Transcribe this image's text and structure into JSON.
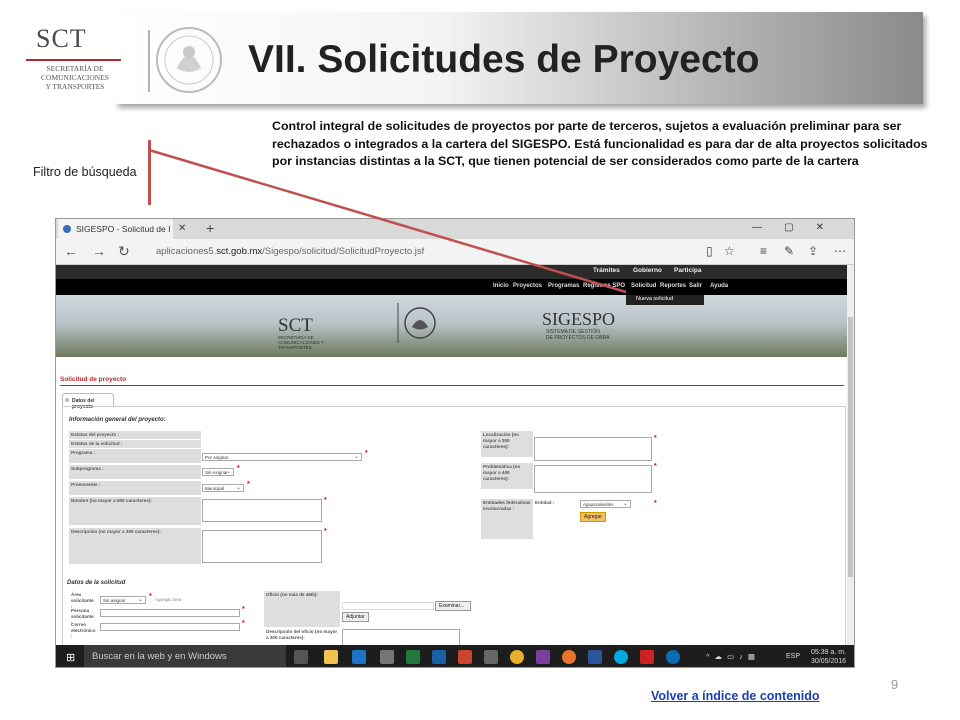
{
  "slide": {
    "title": "VII. Solicitudes de Proyecto",
    "description": "Control integral de solicitudes de proyectos por parte de terceros, sujetos a evaluación preliminar para ser rechazados o integrados a la cartera del SIGESPO. Está funcionalidad es para dar de alta proyectos solicitados por instancias distintas a la SCT, que tienen potencial de ser considerados como parte de la cartera",
    "annotation": "Filtro de búsqueda",
    "page_number": "9",
    "back_link": "Volver a índice de contenido",
    "accent_color": "#c0504d"
  },
  "logo": {
    "sct": "SCT",
    "sct_sub_1": "SECRETARÍA DE",
    "sct_sub_2": "COMUNICACIONES",
    "sct_sub_3": "Y TRANSPORTES"
  },
  "browser": {
    "tab_title": "SIGESPO - Solicitud de I",
    "url_prefix": "aplicaciones5.",
    "url_domain": "sct.gob.mx",
    "url_path": "/Sigespo/solicitud/SolicitudProyecto.jsf"
  },
  "app": {
    "topnav": [
      "Trámites",
      "Gobierno",
      "Participa"
    ],
    "mainnav": [
      "Inicio",
      "Proyectos",
      "Programas",
      "Registros SPO",
      "Solicitud",
      "Reportes",
      "Salir",
      "Ayuda"
    ],
    "dropdown_item": "Nueva solicitud",
    "banner_sct": "SCT",
    "banner_sct_sub": "SECRETARÍA DE COMUNICACIONES Y TRANSPORTES",
    "banner_sig": "SIGESPO",
    "banner_sig_sub_1": "SISTEMA DE GESTIÓN",
    "banner_sig_sub_2": "DE PROYECTOS DE OBRA",
    "section_title": "Solicitud de proyecto",
    "tab": "Datos del proyecto",
    "general_header": "Información general del proyecto:",
    "labels": {
      "estatus_proyecto": "Estatus del proyecto :",
      "estatus_solicitud": "Estatus de la solicitud :",
      "programa": "Programa :",
      "subprograma": "Subprograma :",
      "promovente": "Promovente :",
      "nombre": "Nombre (no mayor a 600 caracteres):",
      "descripcion": "Descripción (no mayor a 300 caracteres):",
      "localizacion": "Localización (no mayor a 300 caracteres):",
      "problematica": "Problemática (no mayor a 400 caracteres):",
      "entidades": "Entidades federativas involucradas :",
      "entidad": "Entidad :"
    },
    "values": {
      "programa": "Por Asignar",
      "subprograma": "Sin Asignar",
      "promovente": "Municipal",
      "entidad": "Aguascalientes",
      "agregar": "Agregar"
    },
    "solicitud_header": "Datos de la solicitud",
    "labels2": {
      "area": "Área solicitante :",
      "persona": "Persona solicitante :",
      "correo": "Correo electrónico :",
      "oficio": "Oficio (no más de 4Mb):",
      "desc_oficio": "Descripción del oficio (no mayor a 300 caracteres):"
    },
    "values2": {
      "area": "Sin asignar",
      "agregar_area": "Agregar área",
      "examinar": "Examinar...",
      "adjuntar": "Adjuntar"
    }
  },
  "taskbar": {
    "search_placeholder": "Buscar en la web y en Windows",
    "lang": "ESP",
    "time": "05:39 a. m.",
    "date": "30/05/2016"
  }
}
